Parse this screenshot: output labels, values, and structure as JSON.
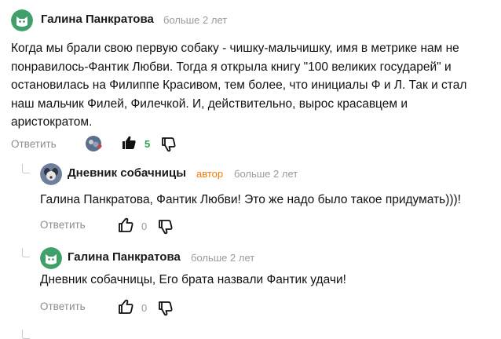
{
  "colors": {
    "avatar_green": "#3fa06a",
    "positive": "#2ea44f",
    "author_badge": "#f57a00",
    "muted": "#9a9a9a"
  },
  "comments": [
    {
      "author": "Галина Панкратова",
      "time": "больше 2 лет",
      "text": "Когда мы брали свою первую собаку - чишку-мальчишку, имя в метрике нам не понравилось-Фантик Любви. Тогда я открыла книгу \"100 великих государей\" и остановилась на Филиппе Красивом, тем более, что инициалы Ф и Л. Так и стал наш мальчик Филей, Филечкой. И, действительно, вырос красавцем и аристократом.",
      "reply_label": "Ответить",
      "likes": "5",
      "liked": true
    },
    {
      "author": "Дневник собачницы",
      "badge": "автор",
      "time": "больше 2 лет",
      "text": "Галина Панкратова, Фантик Любви! Это же надо было такое придумать)))!",
      "reply_label": "Ответить",
      "likes": "0"
    },
    {
      "author": "Галина Панкратова",
      "time": "больше 2 лет",
      "text": "Дневник собачницы, Его брата назвали Фантик удачи!",
      "reply_label": "Ответить",
      "likes": "0"
    }
  ]
}
